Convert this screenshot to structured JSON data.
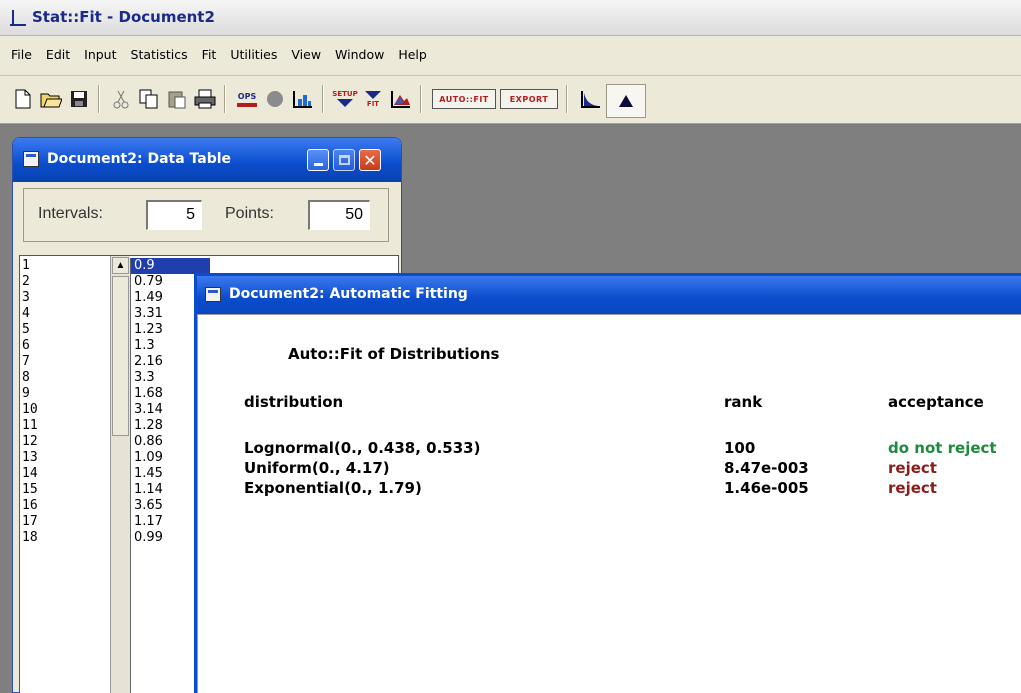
{
  "app": {
    "title": "Stat::Fit - Document2"
  },
  "menu": [
    "File",
    "Edit",
    "Input",
    "Statistics",
    "Fit",
    "Utilities",
    "View",
    "Window",
    "Help"
  ],
  "toolbar": {
    "icons": [
      "new-icon",
      "open-icon",
      "save-icon",
      "cut-icon",
      "copy-icon",
      "paste-icon",
      "print-icon",
      "ops-icon",
      "circle-icon",
      "histogram-icon",
      "setup-icon",
      "fit-icon",
      "mountain-chart-icon",
      "autofit-icon",
      "export-icon",
      "chart-line-icon",
      "triangle-chart-icon"
    ],
    "ops_label": "OPS",
    "setup_label": "SETUP",
    "fit_label": "FIT",
    "autofit_label": "AUTO::FIT",
    "export_label": "EXPORT"
  },
  "data_table": {
    "title": "Document2: Data Table",
    "intervals_label": "Intervals:",
    "intervals_value": "5",
    "points_label": "Points:",
    "points_value": "50",
    "rows": [
      "1",
      "2",
      "3",
      "4",
      "5",
      "6",
      "7",
      "8",
      "9",
      "10",
      "11",
      "12",
      "13",
      "14",
      "15",
      "16",
      "17",
      "18"
    ],
    "values": [
      "0.9",
      "0.79",
      "1.49",
      "3.31",
      "1.23",
      "1.3",
      "2.16",
      "3.3",
      "1.68",
      "3.14",
      "1.28",
      "0.86",
      "1.09",
      "1.45",
      "1.14",
      "3.65",
      "1.17",
      "0.99"
    ]
  },
  "auto_fit": {
    "title": "Document2: Automatic Fitting",
    "heading": "Auto::Fit of Distributions",
    "col_distribution": "distribution",
    "col_rank": "rank",
    "col_acceptance": "acceptance",
    "results": [
      {
        "distribution": "Lognormal(0., 0.438, 0.533)",
        "rank": "100",
        "acceptance": "do not reject"
      },
      {
        "distribution": "Uniform(0., 4.17)",
        "rank": "8.47e-003",
        "acceptance": "reject"
      },
      {
        "distribution": "Exponential(0., 1.79)",
        "rank": "1.46e-005",
        "acceptance": "reject"
      }
    ]
  },
  "colors": {
    "title_blue": "#0a4ccc",
    "accept_green": "#1e8a3c",
    "reject_red": "#8a1c1c"
  }
}
